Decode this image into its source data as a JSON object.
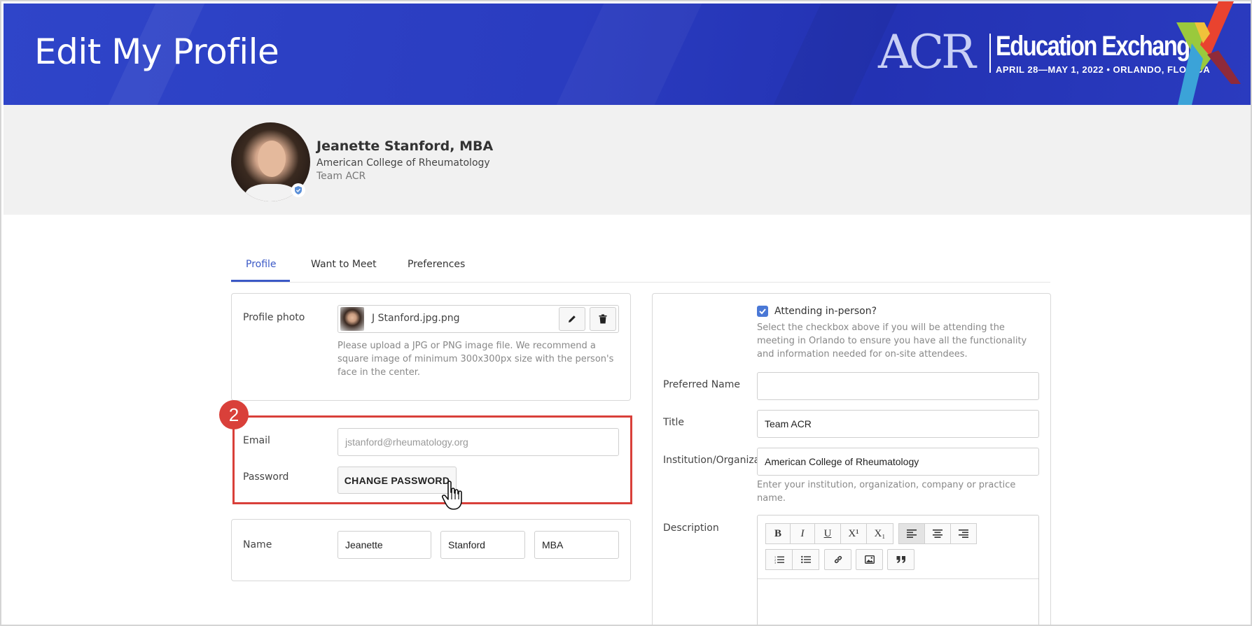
{
  "header": {
    "title": "Edit My Profile",
    "logo_acr": "ACR",
    "logo_title": "Education Exchange",
    "logo_dates": "APRIL 28—MAY 1, 2022 • ORLANDO, FLORIDA",
    "brand_color": "#2a3cc0"
  },
  "profile": {
    "name": "Jeanette Stanford, MBA",
    "organization": "American College of Rheumatology",
    "team": "Team ACR"
  },
  "tabs": [
    {
      "label": "Profile",
      "active": true
    },
    {
      "label": "Want to Meet",
      "active": false
    },
    {
      "label": "Preferences",
      "active": false
    }
  ],
  "photo": {
    "label": "Profile photo",
    "file_name": "J Stanford.jpg.png",
    "help": "Please upload a JPG or PNG image file. We recommend a square image of minimum 300x300px size with the person's face in the center."
  },
  "callout": {
    "number": "2",
    "color": "#d9403a"
  },
  "account": {
    "email_label": "Email",
    "email_value": "jstanford@rheumatology.org",
    "password_label": "Password",
    "change_password": "CHANGE PASSWORD"
  },
  "name_section": {
    "label": "Name",
    "first": "Jeanette",
    "last": "Stanford",
    "suffix": "MBA"
  },
  "right": {
    "attending_label": "Attending in-person?",
    "attending_checked": true,
    "attending_help": "Select the checkbox above if you will be attending the meeting in Orlando to ensure you have all the functionality and information needed for on-site attendees.",
    "preferred_name_label": "Preferred Name",
    "preferred_name_value": "",
    "title_label": "Title",
    "title_value": "Team ACR",
    "institution_label": "Institution/Organizat",
    "institution_value": "American College of Rheumatology",
    "institution_help": "Enter your institution, organization, company or practice name.",
    "description_label": "Description"
  },
  "editor_toolbar": {
    "bold": "B",
    "italic": "I",
    "underline": "U",
    "superscript": "X¹",
    "subscript": "X₁"
  }
}
